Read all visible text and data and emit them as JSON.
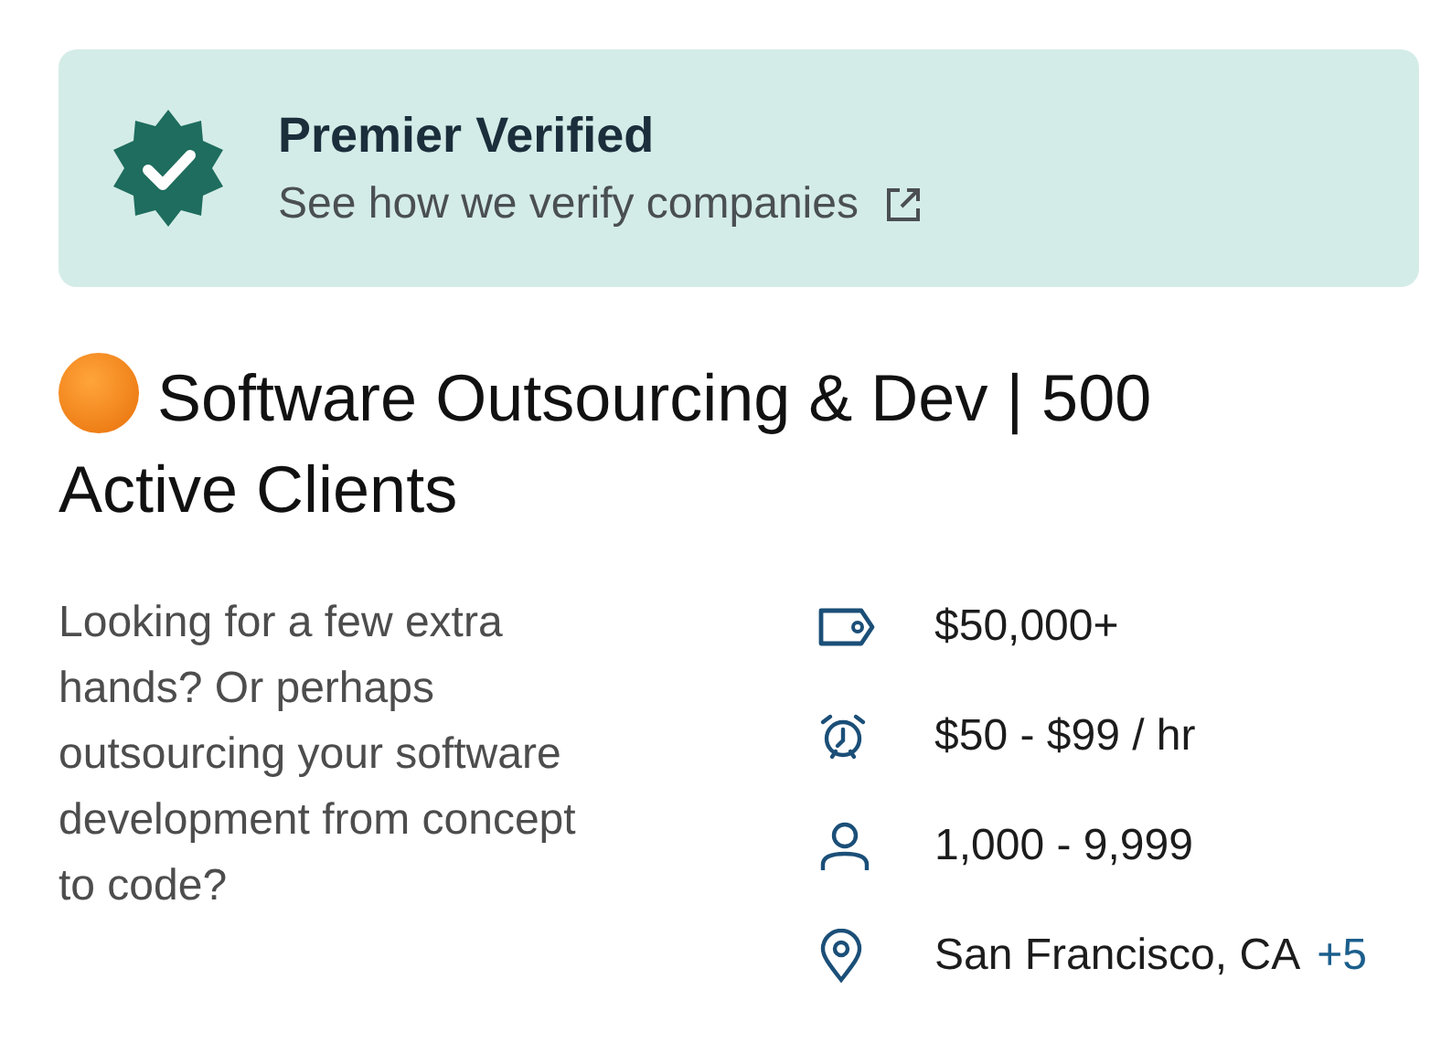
{
  "verification": {
    "title": "Premier Verified",
    "link": "See how we verify companies"
  },
  "listing": {
    "title": "Software Outsourcing & Dev | 500 Active Clients",
    "description": "Looking for a few extra hands? Or perhaps outsourcing your software development from concept to code?",
    "facts": [
      {
        "kind": "budget",
        "text": "$50,000+"
      },
      {
        "kind": "rate",
        "text": "$50 - $99 / hr"
      },
      {
        "kind": "employees",
        "text": "1,000 - 9,999"
      },
      {
        "kind": "location",
        "text": "San Francisco, CA",
        "more": "+5"
      }
    ]
  }
}
